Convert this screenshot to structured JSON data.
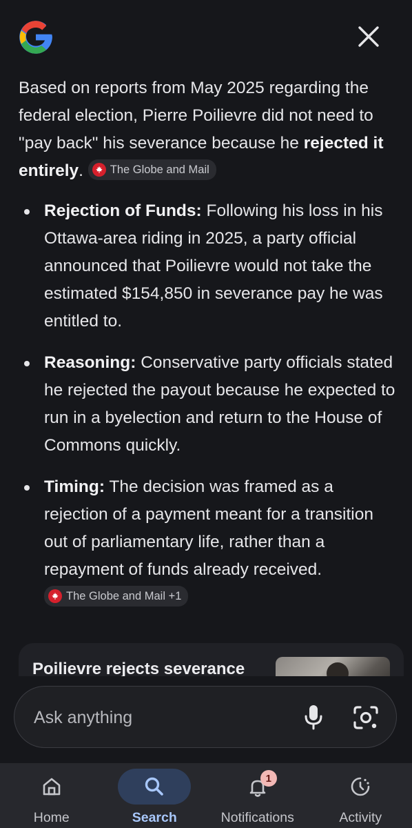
{
  "header": {
    "logo_icon": "google-g-icon",
    "close_icon": "close-icon"
  },
  "answer": {
    "intro_text": "Based on reports from May 2025 regarding the federal election, Pierre Poilievre did not need to \"pay back\" his severance because he ",
    "intro_bold": "rejected it entirely",
    "intro_end": ".",
    "intro_source": "The Globe and Mail",
    "points": [
      {
        "title": "Rejection of Funds:",
        "text": " Following his loss in his Ottawa-area riding in 2025, a party official announced that Poilievre would not take the estimated $154,850 in severance pay he was entitled to."
      },
      {
        "title": "Reasoning:",
        "text": " Conservative party officials stated he rejected the payout because he expected to run in a byelection and return to the House of Commons quickly."
      },
      {
        "title": "Timing:",
        "text": " The decision was framed as a rejection of a payment meant for a transition out of parliamentary life, rather than a repayment of funds already received. ",
        "source": "The Globe and Mail +1"
      }
    ]
  },
  "card": {
    "title": "Poilievre rejects severance"
  },
  "ask": {
    "placeholder": "Ask anything",
    "mic_icon": "mic-icon",
    "lens_icon": "lens-icon"
  },
  "nav": {
    "items": [
      {
        "label": "Home",
        "icon": "home-icon"
      },
      {
        "label": "Search",
        "icon": "search-icon"
      },
      {
        "label": "Notifications",
        "icon": "bell-icon",
        "badge": "1"
      },
      {
        "label": "Activity",
        "icon": "activity-icon"
      }
    ],
    "active": "Search"
  },
  "colors": {
    "background": "#16171b",
    "source_badge": "#d6202c",
    "nav_active": "#a8c7fa",
    "notification_badge": "#f2b8b5"
  }
}
